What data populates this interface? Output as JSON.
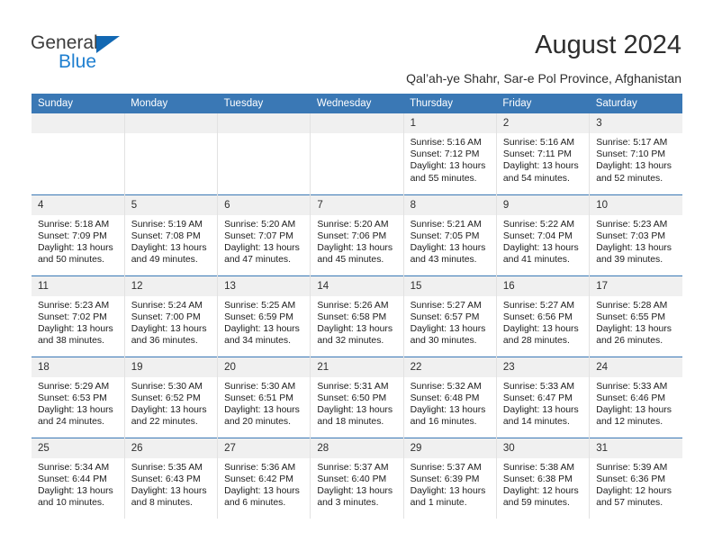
{
  "brand": {
    "name_line1": "General",
    "name_line2": "Blue",
    "triangle_color": "#1268b3",
    "blue_text_color": "#1f7fd0"
  },
  "header": {
    "title": "August 2024",
    "subtitle": "Qal’ah-ye Shahr, Sar-e Pol Province, Afghanistan",
    "accent_color": "#3a78b5",
    "daynum_band_color": "#f0f0f0"
  },
  "weekdays": [
    "Sunday",
    "Monday",
    "Tuesday",
    "Wednesday",
    "Thursday",
    "Friday",
    "Saturday"
  ],
  "weeks": [
    [
      {
        "day": "",
        "empty": true,
        "sunrise": "",
        "sunset": "",
        "daylight1": "",
        "daylight2": ""
      },
      {
        "day": "",
        "empty": true,
        "sunrise": "",
        "sunset": "",
        "daylight1": "",
        "daylight2": ""
      },
      {
        "day": "",
        "empty": true,
        "sunrise": "",
        "sunset": "",
        "daylight1": "",
        "daylight2": ""
      },
      {
        "day": "",
        "empty": true,
        "sunrise": "",
        "sunset": "",
        "daylight1": "",
        "daylight2": ""
      },
      {
        "day": "1",
        "empty": false,
        "sunrise": "Sunrise: 5:16 AM",
        "sunset": "Sunset: 7:12 PM",
        "daylight1": "Daylight: 13 hours",
        "daylight2": "and 55 minutes."
      },
      {
        "day": "2",
        "empty": false,
        "sunrise": "Sunrise: 5:16 AM",
        "sunset": "Sunset: 7:11 PM",
        "daylight1": "Daylight: 13 hours",
        "daylight2": "and 54 minutes."
      },
      {
        "day": "3",
        "empty": false,
        "sunrise": "Sunrise: 5:17 AM",
        "sunset": "Sunset: 7:10 PM",
        "daylight1": "Daylight: 13 hours",
        "daylight2": "and 52 minutes."
      }
    ],
    [
      {
        "day": "4",
        "empty": false,
        "sunrise": "Sunrise: 5:18 AM",
        "sunset": "Sunset: 7:09 PM",
        "daylight1": "Daylight: 13 hours",
        "daylight2": "and 50 minutes."
      },
      {
        "day": "5",
        "empty": false,
        "sunrise": "Sunrise: 5:19 AM",
        "sunset": "Sunset: 7:08 PM",
        "daylight1": "Daylight: 13 hours",
        "daylight2": "and 49 minutes."
      },
      {
        "day": "6",
        "empty": false,
        "sunrise": "Sunrise: 5:20 AM",
        "sunset": "Sunset: 7:07 PM",
        "daylight1": "Daylight: 13 hours",
        "daylight2": "and 47 minutes."
      },
      {
        "day": "7",
        "empty": false,
        "sunrise": "Sunrise: 5:20 AM",
        "sunset": "Sunset: 7:06 PM",
        "daylight1": "Daylight: 13 hours",
        "daylight2": "and 45 minutes."
      },
      {
        "day": "8",
        "empty": false,
        "sunrise": "Sunrise: 5:21 AM",
        "sunset": "Sunset: 7:05 PM",
        "daylight1": "Daylight: 13 hours",
        "daylight2": "and 43 minutes."
      },
      {
        "day": "9",
        "empty": false,
        "sunrise": "Sunrise: 5:22 AM",
        "sunset": "Sunset: 7:04 PM",
        "daylight1": "Daylight: 13 hours",
        "daylight2": "and 41 minutes."
      },
      {
        "day": "10",
        "empty": false,
        "sunrise": "Sunrise: 5:23 AM",
        "sunset": "Sunset: 7:03 PM",
        "daylight1": "Daylight: 13 hours",
        "daylight2": "and 39 minutes."
      }
    ],
    [
      {
        "day": "11",
        "empty": false,
        "sunrise": "Sunrise: 5:23 AM",
        "sunset": "Sunset: 7:02 PM",
        "daylight1": "Daylight: 13 hours",
        "daylight2": "and 38 minutes."
      },
      {
        "day": "12",
        "empty": false,
        "sunrise": "Sunrise: 5:24 AM",
        "sunset": "Sunset: 7:00 PM",
        "daylight1": "Daylight: 13 hours",
        "daylight2": "and 36 minutes."
      },
      {
        "day": "13",
        "empty": false,
        "sunrise": "Sunrise: 5:25 AM",
        "sunset": "Sunset: 6:59 PM",
        "daylight1": "Daylight: 13 hours",
        "daylight2": "and 34 minutes."
      },
      {
        "day": "14",
        "empty": false,
        "sunrise": "Sunrise: 5:26 AM",
        "sunset": "Sunset: 6:58 PM",
        "daylight1": "Daylight: 13 hours",
        "daylight2": "and 32 minutes."
      },
      {
        "day": "15",
        "empty": false,
        "sunrise": "Sunrise: 5:27 AM",
        "sunset": "Sunset: 6:57 PM",
        "daylight1": "Daylight: 13 hours",
        "daylight2": "and 30 minutes."
      },
      {
        "day": "16",
        "empty": false,
        "sunrise": "Sunrise: 5:27 AM",
        "sunset": "Sunset: 6:56 PM",
        "daylight1": "Daylight: 13 hours",
        "daylight2": "and 28 minutes."
      },
      {
        "day": "17",
        "empty": false,
        "sunrise": "Sunrise: 5:28 AM",
        "sunset": "Sunset: 6:55 PM",
        "daylight1": "Daylight: 13 hours",
        "daylight2": "and 26 minutes."
      }
    ],
    [
      {
        "day": "18",
        "empty": false,
        "sunrise": "Sunrise: 5:29 AM",
        "sunset": "Sunset: 6:53 PM",
        "daylight1": "Daylight: 13 hours",
        "daylight2": "and 24 minutes."
      },
      {
        "day": "19",
        "empty": false,
        "sunrise": "Sunrise: 5:30 AM",
        "sunset": "Sunset: 6:52 PM",
        "daylight1": "Daylight: 13 hours",
        "daylight2": "and 22 minutes."
      },
      {
        "day": "20",
        "empty": false,
        "sunrise": "Sunrise: 5:30 AM",
        "sunset": "Sunset: 6:51 PM",
        "daylight1": "Daylight: 13 hours",
        "daylight2": "and 20 minutes."
      },
      {
        "day": "21",
        "empty": false,
        "sunrise": "Sunrise: 5:31 AM",
        "sunset": "Sunset: 6:50 PM",
        "daylight1": "Daylight: 13 hours",
        "daylight2": "and 18 minutes."
      },
      {
        "day": "22",
        "empty": false,
        "sunrise": "Sunrise: 5:32 AM",
        "sunset": "Sunset: 6:48 PM",
        "daylight1": "Daylight: 13 hours",
        "daylight2": "and 16 minutes."
      },
      {
        "day": "23",
        "empty": false,
        "sunrise": "Sunrise: 5:33 AM",
        "sunset": "Sunset: 6:47 PM",
        "daylight1": "Daylight: 13 hours",
        "daylight2": "and 14 minutes."
      },
      {
        "day": "24",
        "empty": false,
        "sunrise": "Sunrise: 5:33 AM",
        "sunset": "Sunset: 6:46 PM",
        "daylight1": "Daylight: 13 hours",
        "daylight2": "and 12 minutes."
      }
    ],
    [
      {
        "day": "25",
        "empty": false,
        "sunrise": "Sunrise: 5:34 AM",
        "sunset": "Sunset: 6:44 PM",
        "daylight1": "Daylight: 13 hours",
        "daylight2": "and 10 minutes."
      },
      {
        "day": "26",
        "empty": false,
        "sunrise": "Sunrise: 5:35 AM",
        "sunset": "Sunset: 6:43 PM",
        "daylight1": "Daylight: 13 hours",
        "daylight2": "and 8 minutes."
      },
      {
        "day": "27",
        "empty": false,
        "sunrise": "Sunrise: 5:36 AM",
        "sunset": "Sunset: 6:42 PM",
        "daylight1": "Daylight: 13 hours",
        "daylight2": "and 6 minutes."
      },
      {
        "day": "28",
        "empty": false,
        "sunrise": "Sunrise: 5:37 AM",
        "sunset": "Sunset: 6:40 PM",
        "daylight1": "Daylight: 13 hours",
        "daylight2": "and 3 minutes."
      },
      {
        "day": "29",
        "empty": false,
        "sunrise": "Sunrise: 5:37 AM",
        "sunset": "Sunset: 6:39 PM",
        "daylight1": "Daylight: 13 hours",
        "daylight2": "and 1 minute."
      },
      {
        "day": "30",
        "empty": false,
        "sunrise": "Sunrise: 5:38 AM",
        "sunset": "Sunset: 6:38 PM",
        "daylight1": "Daylight: 12 hours",
        "daylight2": "and 59 minutes."
      },
      {
        "day": "31",
        "empty": false,
        "sunrise": "Sunrise: 5:39 AM",
        "sunset": "Sunset: 6:36 PM",
        "daylight1": "Daylight: 12 hours",
        "daylight2": "and 57 minutes."
      }
    ]
  ]
}
